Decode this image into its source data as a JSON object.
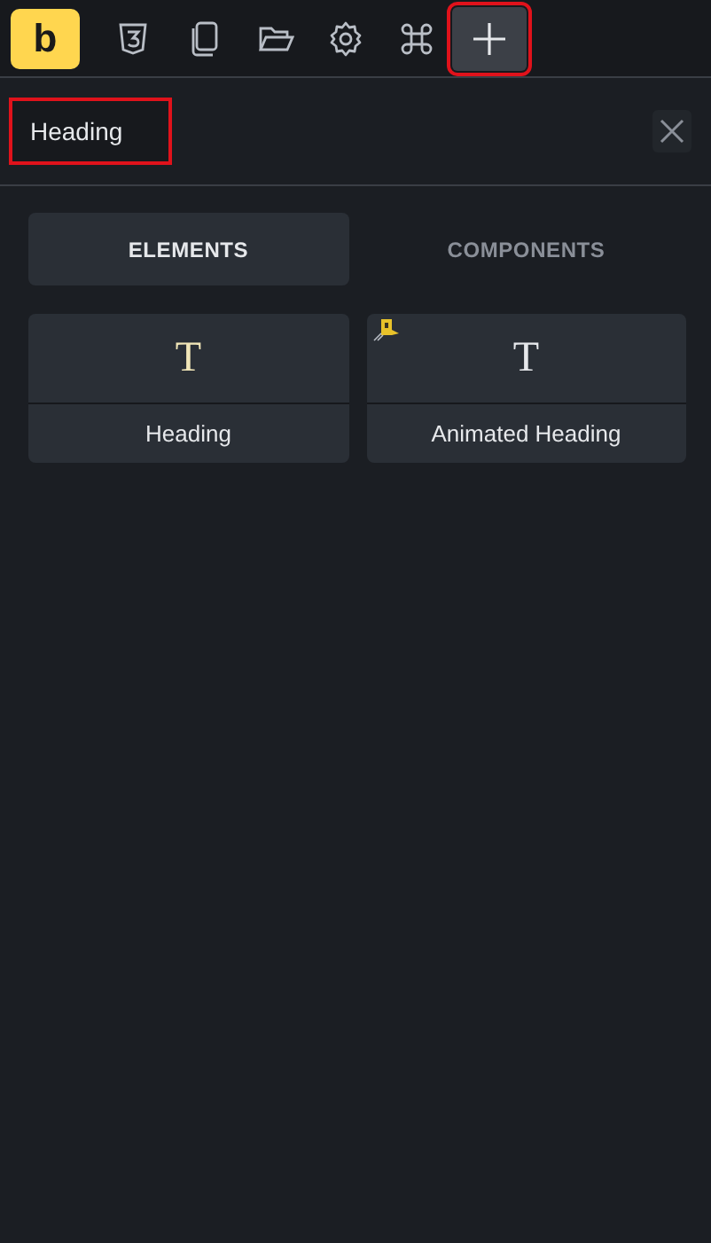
{
  "toolbar": {
    "logo": "b",
    "items": [
      {
        "kind": "css",
        "highlighted": false
      },
      {
        "kind": "pages",
        "highlighted": false
      },
      {
        "kind": "folder",
        "highlighted": false
      },
      {
        "kind": "settings",
        "highlighted": false
      },
      {
        "kind": "command",
        "highlighted": false
      },
      {
        "kind": "add",
        "highlighted": true
      }
    ]
  },
  "search": {
    "value": "Heading",
    "highlighted": true
  },
  "tabs": [
    {
      "label": "ELEMENTS",
      "selected": true
    },
    {
      "label": "COMPONENTS",
      "selected": false
    }
  ],
  "elements": [
    {
      "glyph": "T",
      "label": "Heading",
      "pro": false
    },
    {
      "glyph": "T",
      "label": "Animated Heading",
      "pro": true
    }
  ]
}
